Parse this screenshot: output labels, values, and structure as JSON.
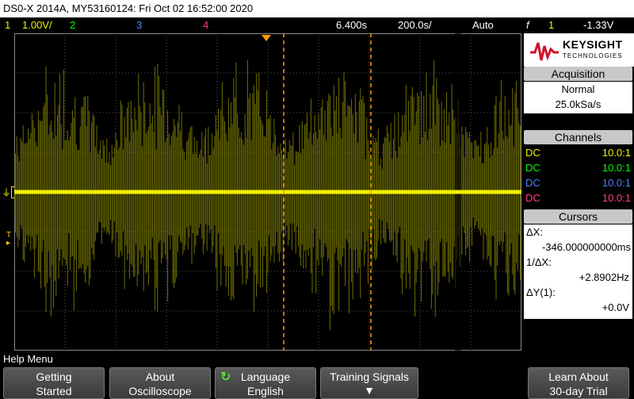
{
  "title_bar": {
    "text": "DS0-X 2014A, MY53160124: Fri Oct 02 16:52:00 2020"
  },
  "status": {
    "ch1_label": "1",
    "ch1_scale": "1.00V/",
    "ch2_label": "2",
    "ch3_label": "3",
    "ch4_label": "4",
    "time_pos": "6.400s",
    "time_div": "200.0s/",
    "trigger_mode": "Auto",
    "trigger_icon": "f",
    "trigger_ch": "1",
    "trigger_level": "-1.33V"
  },
  "colors": {
    "ch1": "#f0f000",
    "ch2": "#00ff00",
    "ch3": "#4f7fff",
    "ch4": "#ff3f7f",
    "cursor": "#ff9900"
  },
  "logo": {
    "brand": "KEYSIGHT",
    "sub": "TECHNOLOGIES"
  },
  "acquisition": {
    "header": "Acquisition",
    "mode": "Normal",
    "rate": "25.0kSa/s"
  },
  "channels": {
    "header": "Channels",
    "rows": [
      {
        "coupling": "DC",
        "probe": "10.0:1"
      },
      {
        "coupling": "DC",
        "probe": "10.0:1"
      },
      {
        "coupling": "DC",
        "probe": "10.0:1"
      },
      {
        "coupling": "DC",
        "probe": "10.0:1"
      }
    ]
  },
  "cursors": {
    "header": "Cursors",
    "dx_label": "ΔX:",
    "dx_value": "-346.000000000ms",
    "inv_dx_label": "1/ΔX:",
    "inv_dx_value": "+2.8902Hz",
    "dy_label": "ΔY(1):",
    "dy_value": "+0.0V"
  },
  "trace": {
    "ground_marker": "1",
    "trigger_marker": "T"
  },
  "help_menu": {
    "label": "Help Menu"
  },
  "softkeys": [
    {
      "line1": "Getting",
      "line2": "Started"
    },
    {
      "line1": "About",
      "line2": "Oscilloscope"
    },
    {
      "line1": "Language",
      "line2": "English"
    },
    {
      "line1": "Training Signals",
      "line2": ""
    },
    {
      "line1": "Learn About",
      "line2": "30-day Trial"
    }
  ]
}
